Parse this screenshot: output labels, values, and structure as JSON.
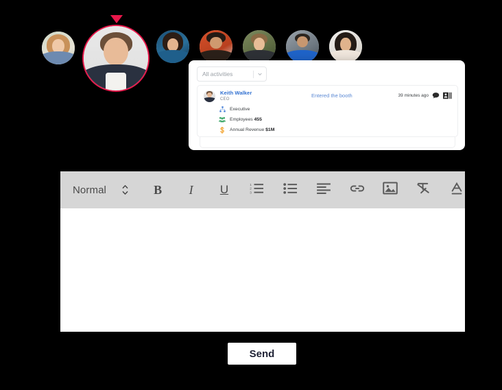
{
  "theme": {
    "canvas_bg": "#000000",
    "panel_bg": "#ffffff",
    "toolbar_bg": "#d6d6d6",
    "accent_red": "#e8174a",
    "link_blue": "#5b89d4",
    "name_blue": "#2f6fd0",
    "fact_blue": "#3f7bd6",
    "fact_green": "#3fa86b",
    "fact_orange": "#f2a32e",
    "send_text": "#1f2235"
  },
  "avatars": {
    "highlight_marker_icon": "triangle-down-marker",
    "items": [
      {
        "id": "avatar-1",
        "selected": false
      },
      {
        "id": "avatar-2-speaker",
        "selected": true
      },
      {
        "id": "avatar-3",
        "selected": false
      },
      {
        "id": "avatar-4",
        "selected": false
      },
      {
        "id": "avatar-5",
        "selected": false
      },
      {
        "id": "avatar-6",
        "selected": false
      },
      {
        "id": "avatar-7",
        "selected": false
      }
    ]
  },
  "activity_panel": {
    "filter": {
      "selected": "All activities",
      "chevron_icon": "chevron-down-icon",
      "options": [
        "All activities"
      ]
    },
    "entries": [
      {
        "name": "Keith Walker",
        "role": "CEO",
        "event": "Entered the booth",
        "time": "39 minutes ago",
        "chat_icon": "chat-bubble-icon",
        "contact_icon": "contact-card-icon",
        "facts": [
          {
            "icon": "hierarchy-icon",
            "label": "Executive",
            "value": ""
          },
          {
            "icon": "people-icon",
            "label": "Employees",
            "value": "455"
          },
          {
            "icon": "dollar-icon",
            "label": "Annual Revenue",
            "value": "$1M"
          }
        ]
      }
    ]
  },
  "editor": {
    "toolbar": {
      "style_label": "Normal",
      "stepper_icon": "stepper-updown-icon",
      "buttons": [
        {
          "name": "bold-button",
          "glyph": "B"
        },
        {
          "name": "italic-button",
          "glyph": "I"
        },
        {
          "name": "underline-button",
          "glyph": "U"
        },
        {
          "name": "ordered-list-button",
          "icon": "ordered-list-icon"
        },
        {
          "name": "bullet-list-button",
          "icon": "bullet-list-icon"
        },
        {
          "name": "align-left-button",
          "icon": "align-left-icon"
        },
        {
          "name": "link-button",
          "icon": "link-icon"
        },
        {
          "name": "image-button",
          "icon": "image-icon"
        },
        {
          "name": "clear-format-button",
          "icon": "clear-formatting-icon"
        },
        {
          "name": "text-color-button",
          "icon": "text-color-icon"
        }
      ]
    },
    "body": {
      "value": "",
      "placeholder": ""
    }
  },
  "send": {
    "label": "Send"
  }
}
